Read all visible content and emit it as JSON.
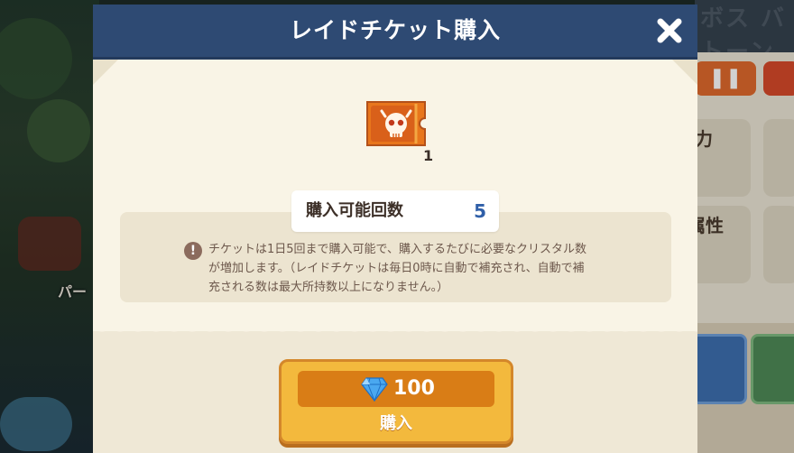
{
  "dialog": {
    "title": "レイドチケット購入",
    "close_icon": "close-icon",
    "ticket": {
      "icon": "raid-ticket-skull-icon",
      "quantity": "1"
    },
    "purchase_count": {
      "label": "購入可能回数",
      "value": "5"
    },
    "notice": {
      "icon": "warning-icon",
      "text": "チケットは1日5回まで購入可能で、購入するたびに必要なクリスタル数が増加します。（レイドチケットは毎日0時に自動で補充され、自動で補充される数は最大所持数以上になりません。）"
    },
    "buy_button": {
      "price_icon": "crystal-gem-icon",
      "price": "100",
      "label": "購入"
    }
  },
  "background": {
    "left_label": "パー",
    "right_top_text": "ボス バトーン",
    "right_card_1": "力",
    "right_card_2": "属性"
  },
  "colors": {
    "header": "#2e4a73",
    "panel": "#f9f4e6",
    "button": "#f3b93d",
    "price_bar": "#d97d16",
    "count_value": "#2f5fa8"
  }
}
